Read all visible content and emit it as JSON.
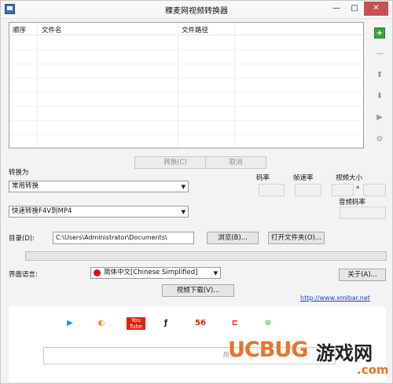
{
  "window": {
    "title": "稞麦网视频转换器",
    "minimize": "—",
    "maximize": "□",
    "close": "✕"
  },
  "table": {
    "columns": [
      "顺序",
      "文件名",
      "文件路径"
    ]
  },
  "side_buttons": [
    "add-icon",
    "remove-icon",
    "move-up-icon",
    "move-down-icon",
    "play-icon",
    "settings-icon"
  ],
  "actions": {
    "convert": "转换(C)",
    "cancel": "取消"
  },
  "convert_section": {
    "label": "转换为",
    "category": "常用转换",
    "format": "快速转换F4V到MP4",
    "bitrate_label": "码率",
    "framerate_label": "帧速率",
    "size_label": "视频大小",
    "size_sep": "*",
    "audio_bitrate_label": "音频码率"
  },
  "directory": {
    "label": "目录(D):",
    "path": "C:\\Users\\Administrator\\Documents\\",
    "browse": "浏览(B)...",
    "open_folder": "打开文件夹(O)..."
  },
  "progress": {
    "percent": 0
  },
  "language": {
    "label": "界面语言:",
    "value": "简体中文[Chinese Simplified]",
    "about": "关于(A)..."
  },
  "download_button": "视频下载(V)...",
  "website_link": "http://www.xmlbar.net",
  "bottom_panel": {
    "logos": [
      "▶",
      "◐",
      "You Tube",
      "ƒ",
      "56",
      "⊏",
      "⊛"
    ],
    "search_text": "所有"
  },
  "watermark": {
    "brand": "UCBUG",
    "text": "游戏网",
    "domain": ".com"
  },
  "colors": {
    "accent_green": "#3ea339",
    "link_blue": "#1a46c4",
    "close_red": "#c75050"
  }
}
